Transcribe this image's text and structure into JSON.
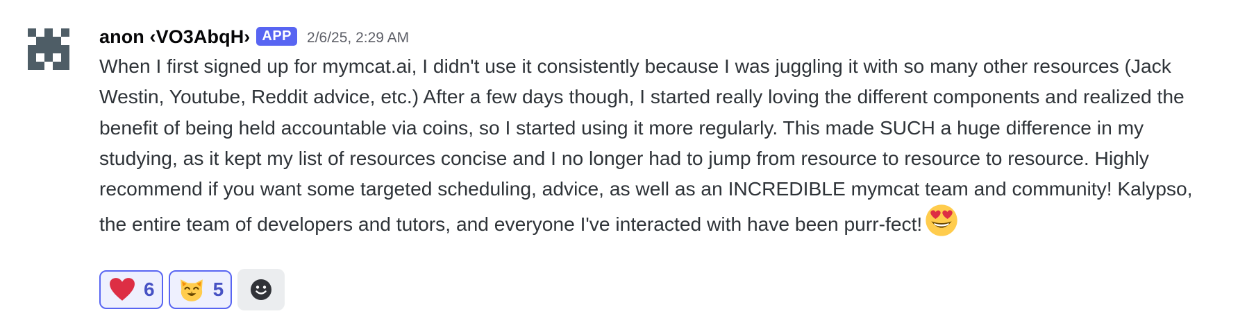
{
  "message": {
    "author": {
      "name": "anon ‹VO3AbqH›",
      "badge": "APP",
      "avatar_icon": "pixel-invader-avatar-icon"
    },
    "timestamp": "2/6/25, 2:29 AM",
    "content": "When I first signed up for mymcat.ai, I didn't use it consistently because I was juggling it with so many other resources (Jack Westin, Youtube, Reddit advice, etc.) After a few days though, I started really loving the different components and realized the benefit of being held accountable via coins, so I started using it more regularly. This made SUCH a huge difference in my studying, as it kept my list of resources concise and I no longer had to jump from resource to resource to resource. Highly recommend if you want some targeted scheduling, advice, as well as an INCREDIBLE mymcat team and community! Kalypso, the entire team of developers and tutors, and everyone I've interacted with have been purr-fect!",
    "trailing_emoji": "heart-eyes-emoji-icon",
    "reactions": [
      {
        "emoji": "red-heart-emoji-icon",
        "count": "6"
      },
      {
        "emoji": "smiling-cat-emoji-icon",
        "count": "5"
      }
    ],
    "add_reaction_icon": "add-reaction-icon"
  },
  "colors": {
    "badge_bg": "#5865f2",
    "reaction_border": "#5865f2",
    "reaction_bg": "#eef0fe",
    "reaction_count": "#4752c4",
    "text": "#2e3338",
    "timestamp": "#5c5e66",
    "avatar": "#4e5d66"
  }
}
